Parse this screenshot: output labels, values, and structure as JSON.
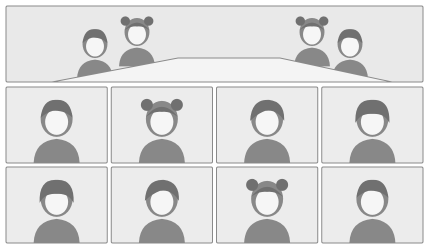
{
  "colors": {
    "page_background": "#ffffff",
    "panel_fill": "#e9e9e9",
    "tile_fill": "#ececec",
    "tile_border": "#8a8a8a",
    "avatar_fill": "#888888",
    "avatar_hair": "#707070",
    "table_fill": "#f4f4f4"
  },
  "stage_view": {
    "participants_shown": 4,
    "participant_icons": [
      "person-icon",
      "person-pigtails-icon",
      "person-pigtails-icon",
      "person-icon"
    ]
  },
  "gallery": {
    "rows": 2,
    "columns": 4,
    "tiles": [
      {
        "icon": "person-short-hair-icon"
      },
      {
        "icon": "person-pigtails-icon"
      },
      {
        "icon": "person-side-part-icon"
      },
      {
        "icon": "person-bangs-icon"
      },
      {
        "icon": "person-bangs-icon"
      },
      {
        "icon": "person-side-part-icon"
      },
      {
        "icon": "person-pigtails-icon"
      },
      {
        "icon": "person-short-hair-icon"
      }
    ]
  }
}
